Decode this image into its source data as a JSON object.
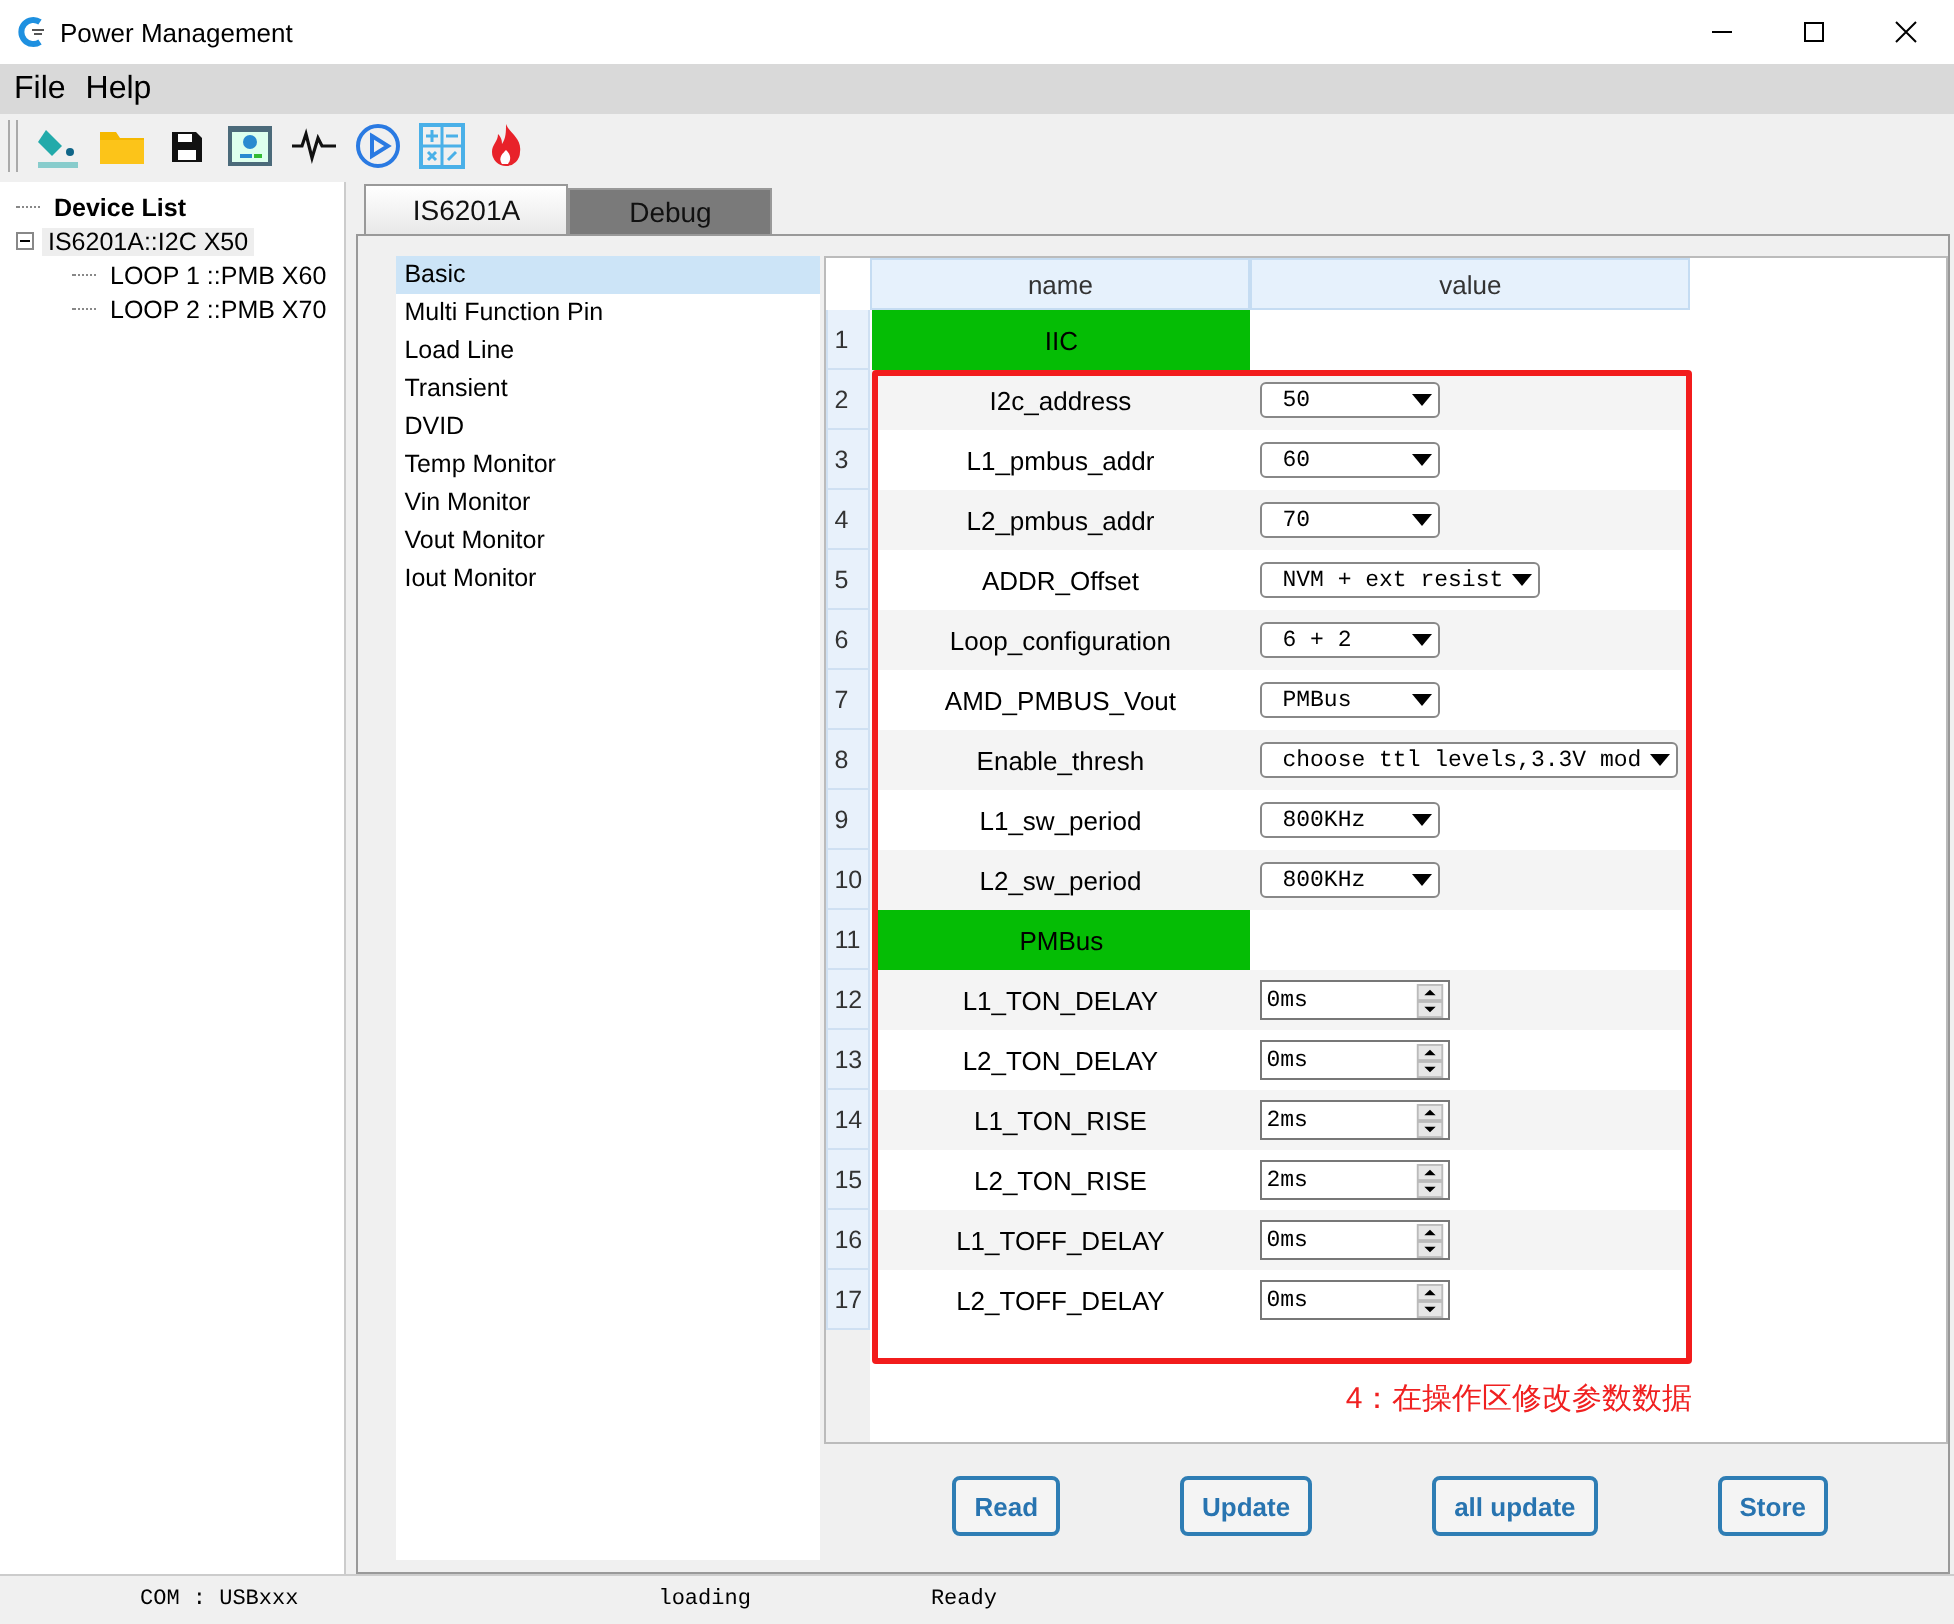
{
  "window": {
    "title": "Power Management"
  },
  "menu": [
    "File",
    "Help"
  ],
  "tree": {
    "label": "Device List",
    "children": [
      {
        "label": "IS6201A::I2C X50",
        "selected": true,
        "expanded": true,
        "children": [
          {
            "label": "LOOP 1 ::PMB X60",
            "selected": false
          },
          {
            "label": "LOOP 2 ::PMB X70",
            "selected": false
          }
        ]
      }
    ]
  },
  "tabs": [
    {
      "label": "IS6201A",
      "selected": true
    },
    {
      "label": "Debug",
      "selected": false
    }
  ],
  "categories": [
    {
      "label": "Basic",
      "selected": true
    },
    {
      "label": "Multi Function Pin",
      "selected": false
    },
    {
      "label": "Load Line",
      "selected": false
    },
    {
      "label": "Transient",
      "selected": false
    },
    {
      "label": "DVID",
      "selected": false
    },
    {
      "label": "Temp Monitor",
      "selected": false
    },
    {
      "label": "Vin Monitor",
      "selected": false
    },
    {
      "label": "Vout Monitor",
      "selected": false
    },
    {
      "label": "Iout Monitor",
      "selected": false
    }
  ],
  "table": {
    "columns": [
      "name",
      "value"
    ],
    "rows": [
      {
        "number": "1",
        "kind": "section",
        "name": "IIC"
      },
      {
        "number": "2",
        "kind": "dropdown",
        "name": "I2c_address",
        "value": "50"
      },
      {
        "number": "3",
        "kind": "dropdown",
        "name": "L1_pmbus_addr",
        "value": "60"
      },
      {
        "number": "4",
        "kind": "dropdown",
        "name": "L2_pmbus_addr",
        "value": "70"
      },
      {
        "number": "5",
        "kind": "dropdown",
        "name": "ADDR_Offset",
        "value": "NVM + ext resist"
      },
      {
        "number": "6",
        "kind": "dropdown",
        "name": "Loop_configuration",
        "value": "6 + 2"
      },
      {
        "number": "7",
        "kind": "dropdown",
        "name": "AMD_PMBUS_Vout",
        "value": "PMBus"
      },
      {
        "number": "8",
        "kind": "dropdown",
        "name": "Enable_thresh",
        "value": "choose ttl levels,3.3V mod"
      },
      {
        "number": "9",
        "kind": "dropdown",
        "name": "L1_sw_period",
        "value": "800KHz"
      },
      {
        "number": "10",
        "kind": "dropdown",
        "name": "L2_sw_period",
        "value": "800KHz"
      },
      {
        "number": "11",
        "kind": "section",
        "name": "PMBus"
      },
      {
        "number": "12",
        "kind": "spin",
        "name": "L1_TON_DELAY",
        "value": "0ms"
      },
      {
        "number": "13",
        "kind": "spin",
        "name": "L2_TON_DELAY",
        "value": "0ms"
      },
      {
        "number": "14",
        "kind": "spin",
        "name": "L1_TON_RISE",
        "value": "2ms"
      },
      {
        "number": "15",
        "kind": "spin",
        "name": "L2_TON_RISE",
        "value": "2ms"
      },
      {
        "number": "16",
        "kind": "spin",
        "name": "L1_TOFF_DELAY",
        "value": "0ms"
      },
      {
        "number": "17",
        "kind": "spin",
        "name": "L2_TOFF_DELAY",
        "value": "0ms"
      }
    ]
  },
  "annotation": "4：在操作区修改参数数据",
  "buttons": [
    "Read",
    "Update",
    "all update",
    "Store"
  ],
  "status_bar": [
    "COM : USBxxx",
    "loading",
    "Ready"
  ]
}
